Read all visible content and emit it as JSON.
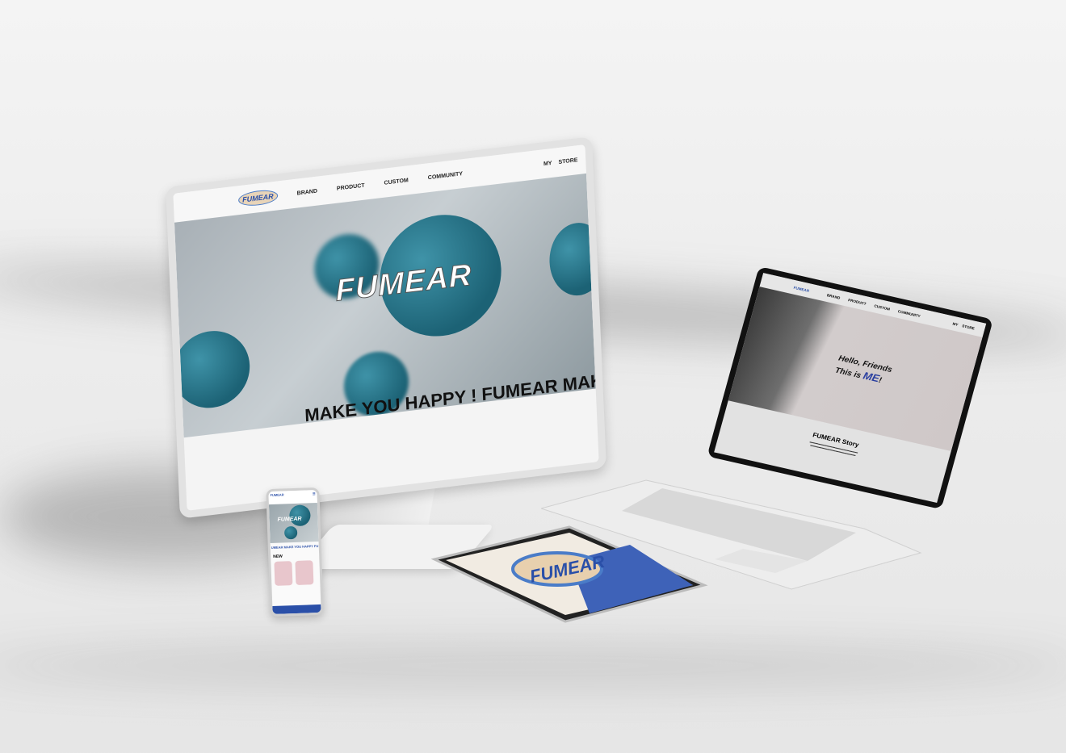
{
  "desktop": {
    "logo": "FUMEAR",
    "nav": [
      "BRAND",
      "PRODUCT",
      "CUSTOM",
      "COMMUNITY"
    ],
    "util": [
      "MY",
      "STORE"
    ],
    "hero_title": "FUMEAR",
    "marquee": "MAKE YOU HAPPY !  FUMEAR  MAKE"
  },
  "laptop": {
    "logo": "FUMEAR",
    "nav": [
      "BRAND",
      "PRODUCT",
      "CUSTOM",
      "COMMUNITY"
    ],
    "util": [
      "MY",
      "STORE"
    ],
    "hello_line1": "Hello, Friends",
    "hello_line2": "This is ",
    "hello_me": "ME",
    "hello_end": "!",
    "story_title": "FUMEAR Story"
  },
  "phone": {
    "logo": "FUMEAR",
    "hero_title": "FUMEAR",
    "marquee": "UMEAR  MAKE YOU HAPPY  FU",
    "new_label": "NEW"
  },
  "tablet": {
    "logo": "FUMEAR"
  },
  "colors": {
    "brand_blue": "#2a4fa8",
    "teal": "#1c6275"
  }
}
